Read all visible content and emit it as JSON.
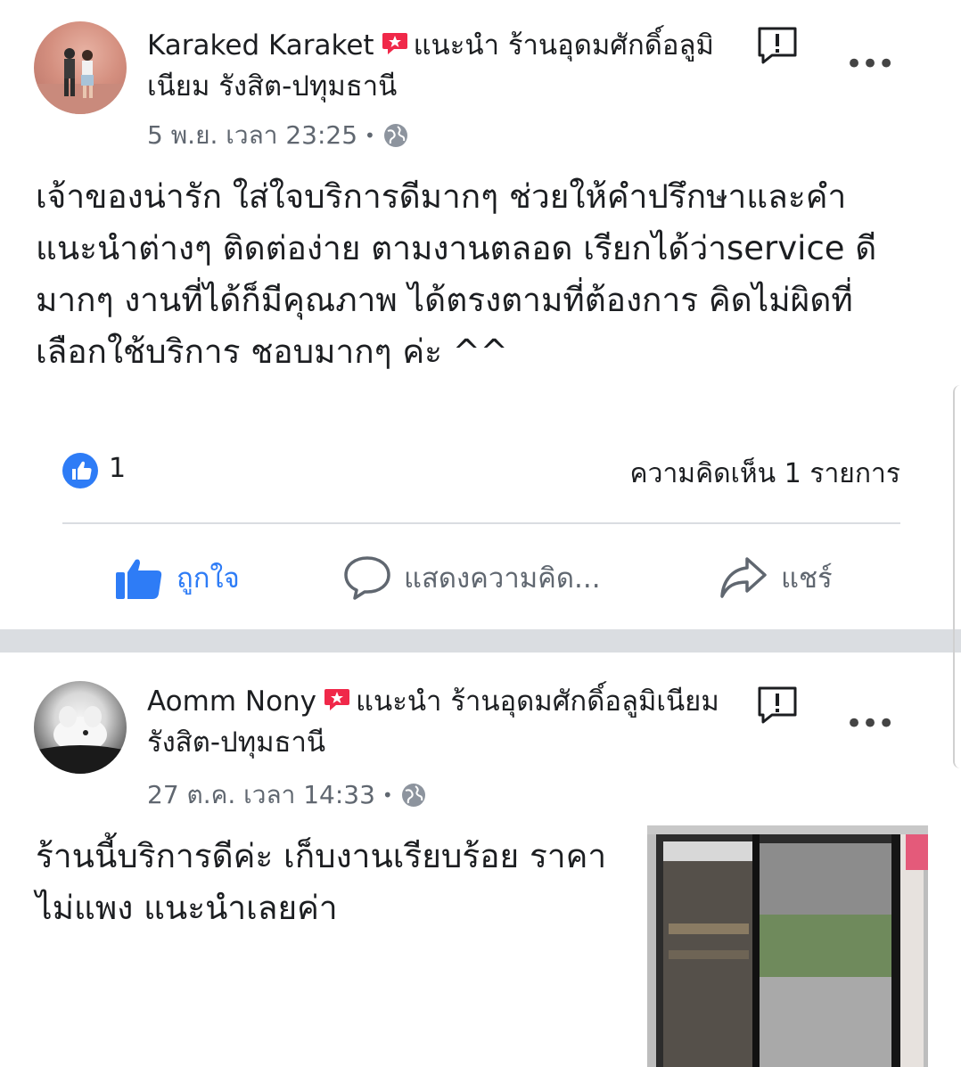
{
  "posts": [
    {
      "author": "Karaked Karaket",
      "recommend_label": "แนะนำ",
      "page_name": "ร้านอุดมศักดิ์อลูมิเนียม รังสิต-ปทุมธานี",
      "date": "5 พ.ย. เวลา 23:25",
      "text": "เจ้าของน่ารัก ใส่ใจบริการดีมากๆ ช่วยให้คำปรึกษาและคำแนะนำต่างๆ ติดต่อง่าย ตามงานตลอด เรียกได้ว่าservice ดีมากๆ งานที่ได้ก็มีคุณภาพ ได้ตรงตามที่ต้องการ คิดไม่ผิดที่เลือกใช้บริการ ชอบมากๆ ค่ะ ^^",
      "like_count": "1",
      "comment_count": "ความคิดเห็น 1 รายการ",
      "actions": {
        "like": "ถูกใจ",
        "comment": "แสดงความคิด...",
        "share": "แชร์"
      }
    },
    {
      "author": "Aomm Nony",
      "recommend_label": "แนะนำ",
      "page_name": "ร้านอุดมศักดิ์อลูมิเนียม รังสิต-ปทุมธานี",
      "date": "27 ต.ค. เวลา 14:33",
      "text": "ร้านนี้บริการดีค่ะ เก็บงานเรียบร้อย ราคาไม่แพง แนะนำเลยค่า"
    }
  ],
  "colors": {
    "accent": "#2e7cf6",
    "recommend": "#f02849",
    "muted": "#606770",
    "divider": "#dadde1"
  },
  "icons": [
    "recommend-badge-icon",
    "globe-icon",
    "report-icon",
    "more-icon",
    "like-icon",
    "comment-icon",
    "share-icon"
  ]
}
